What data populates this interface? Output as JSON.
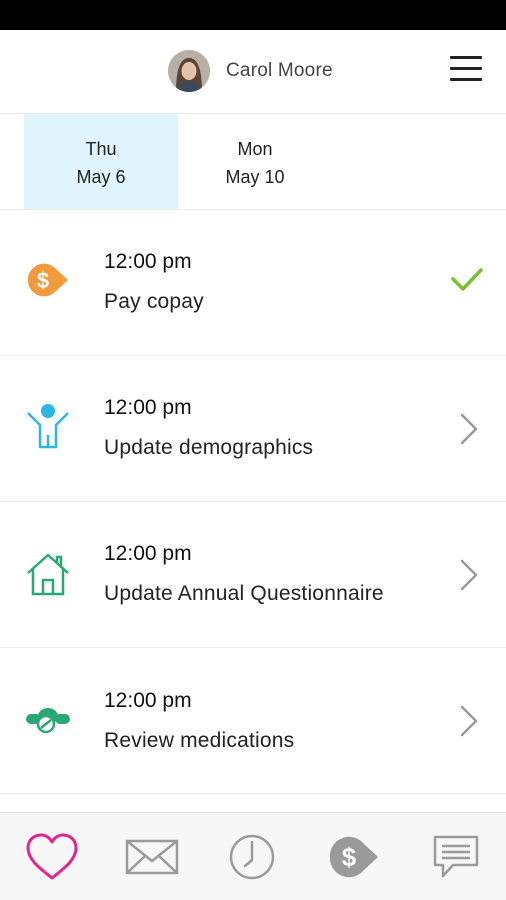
{
  "header": {
    "user_name": "Carol Moore",
    "avatar": "avatar-photo",
    "menu_icon": "hamburger-menu-icon"
  },
  "date_tabs": [
    {
      "day": "Thu",
      "date": "May 6",
      "selected": true
    },
    {
      "day": "Mon",
      "date": "May 10",
      "selected": false
    }
  ],
  "tasks": [
    {
      "time": "12:00 pm",
      "title": "Pay copay",
      "icon": "dollar-tag-icon",
      "status": "checkmark-icon",
      "icon_color": "#f39a3c",
      "status_color": "#7cbf2f"
    },
    {
      "time": "12:00 pm",
      "title": "Update demographics",
      "icon": "person-icon",
      "status": "chevron-right-icon",
      "icon_color": "#2bb5e8"
    },
    {
      "time": "12:00 pm",
      "title": "Update Annual Questionnaire",
      "icon": "house-icon",
      "status": "chevron-right-icon",
      "icon_color": "#2aa873"
    },
    {
      "time": "12:00 pm",
      "title": "Review medications",
      "icon": "pills-icon",
      "status": "chevron-right-icon",
      "icon_color": "#2aa873"
    }
  ],
  "bottom_nav": [
    {
      "icon": "heart-icon",
      "active": true,
      "color": "#e5258f"
    },
    {
      "icon": "envelope-icon",
      "active": false
    },
    {
      "icon": "clock-icon",
      "active": false
    },
    {
      "icon": "dollar-tag-icon",
      "active": false
    },
    {
      "icon": "chat-icon",
      "active": false
    }
  ],
  "colors": {
    "selected_tab_bg": "#dff4fd",
    "inactive_icon": "#9a9a9a"
  }
}
